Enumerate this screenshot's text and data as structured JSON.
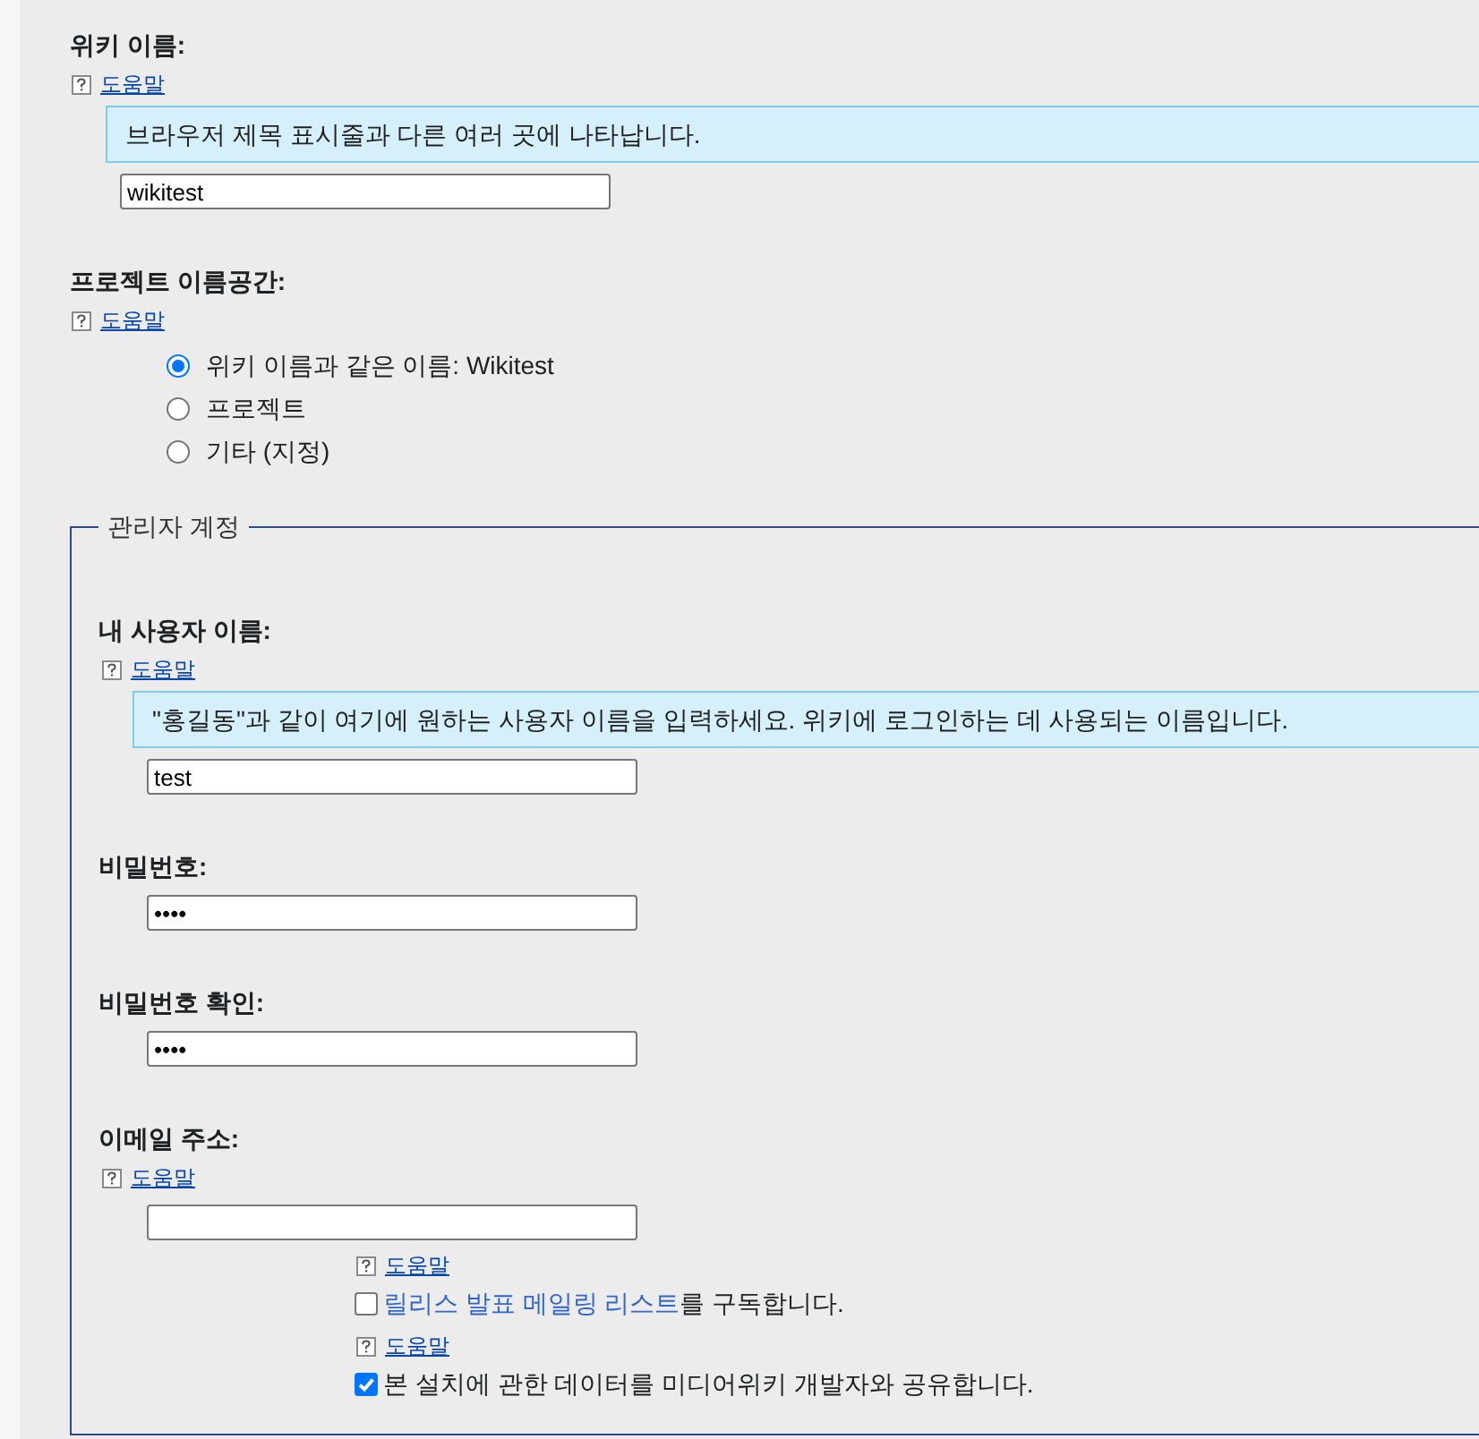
{
  "settings": [
    {
      "kind": "text",
      "label": "위키 이름:",
      "help": "도움말",
      "hint": "브라우저 제목 표시줄과 다른 여러 곳에 나타납니다.",
      "value": "wikitest"
    },
    {
      "kind": "radio",
      "label": "프로젝트 이름공간:",
      "help": "도움말",
      "options": [
        {
          "label": "위키 이름과 같은 이름: Wikitest",
          "selected": true
        },
        {
          "label": "프로젝트",
          "selected": false
        },
        {
          "label": "기타 (지정)",
          "selected": false
        }
      ]
    }
  ],
  "admin_account": {
    "legend": "관리자 계정",
    "fields": [
      {
        "kind": "text",
        "label": "내 사용자 이름:",
        "help": "도움말",
        "hint": "\"홍길동\"과 같이 여기에 원하는 사용자 이름을 입력하세요. 위키에 로그인하는 데 사용되는 이름입니다.",
        "value": "test"
      },
      {
        "kind": "password",
        "label": "비밀번호:",
        "value": "••••"
      },
      {
        "kind": "password",
        "label": "비밀번호 확인:",
        "value": "••••"
      },
      {
        "kind": "text",
        "label": "이메일 주소:",
        "help": "도움말"
      }
    ],
    "options": [
      {
        "help": "도움말",
        "link": "릴리스 발표 메일링 리스트",
        "text": "를 구독합니다.",
        "checked": false
      },
      {
        "help": "도움말",
        "text": "본 설치에 관한 데이터를 미디어위키 개발자와 공유합니다.",
        "checked": true
      }
    ]
  }
}
